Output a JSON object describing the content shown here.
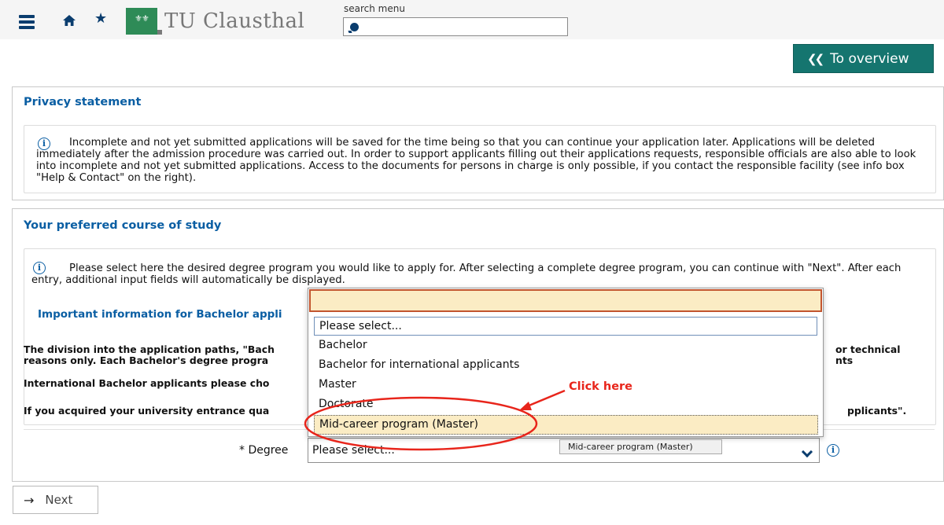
{
  "header": {
    "logo_text": "TU Clausthal",
    "logo_mark": "⚜⚜",
    "search_label": "search menu",
    "search_value": "",
    "icons": [
      "menu-icon",
      "home-icon",
      "star-icon",
      "search-icon"
    ]
  },
  "overview_button": {
    "label": "To overview",
    "icon": "double-chevron-left-icon"
  },
  "privacy": {
    "title": "Privacy statement",
    "text": "Incomplete and not yet submitted applications will be saved for the time being so that you can continue your application later. Applications will be deleted immediately after the admission procedure was carried out. In order to support applicants filling out their applications requests, responsible officials are also able to look into incomplete and not yet submitted applications. Access to the documents for persons in charge is only possible, if you contact the responsible facility (see info box \"Help & Contact\" on the right)."
  },
  "course": {
    "title": "Your preferred course of study",
    "info_text": "Please select here the desired degree program you would like to apply for. After selecting a complete degree program, you can continue with \"Next\". After each entry, additional input fields will automatically be displayed.",
    "bachelor_heading": "Important information for Bachelor appli",
    "line1a": "The division into the application paths, \"Bach",
    "line1b": "reasons only. Each Bachelor's degree progra",
    "line1c": "or technical",
    "line1d": "nts",
    "line2": "International Bachelor applicants please cho",
    "line3a": "If you acquired your university entrance qua",
    "line3b": "pplicants\".",
    "degree_label": "* Degree",
    "degree_value": "Please select..."
  },
  "dropdown": {
    "filter_value": "",
    "options": [
      "Please select...",
      "Bachelor",
      "Bachelor for international applicants",
      "Master",
      "Doctorate",
      "Mid-career program (Master)"
    ],
    "highlighted_index": 5,
    "tooltip": "Mid-career program (Master)"
  },
  "annotation": {
    "label": "Click here",
    "color": "#e8251b"
  },
  "next_button": {
    "label": "Next",
    "icon": "arrow-right-icon"
  },
  "colors": {
    "brand_blue": "#0a5ea3",
    "nav_dark": "#0a3d6e",
    "teal_button": "#15756f",
    "highlight_bg": "#fbecc4",
    "focus_border": "#c2552e"
  }
}
